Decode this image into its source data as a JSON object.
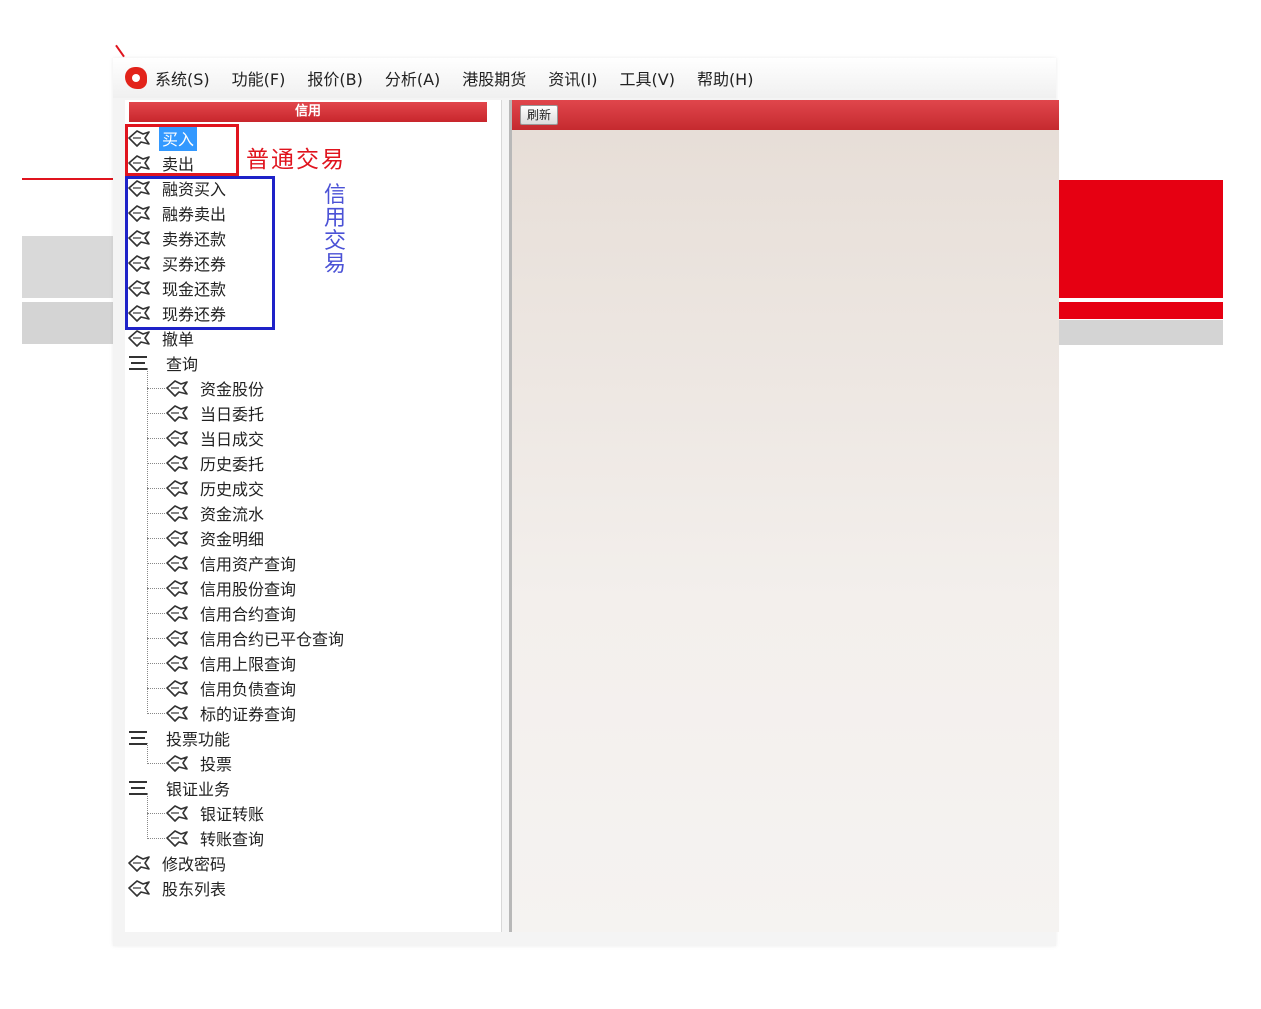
{
  "menubar": {
    "items": [
      "系统(S)",
      "功能(F)",
      "报价(B)",
      "分析(A)",
      "港股期货",
      "资讯(I)",
      "工具(V)",
      "帮助(H)"
    ]
  },
  "left_panel": {
    "header": "信用"
  },
  "tree": {
    "top_items": [
      "买入",
      "卖出",
      "融资买入",
      "融券卖出",
      "卖券还款",
      "买券还券",
      "现金还款",
      "现券还券",
      "撤单"
    ],
    "query_group": "查询",
    "query_items": [
      "资金股份",
      "当日委托",
      "当日成交",
      "历史委托",
      "历史成交",
      "资金流水",
      "资金明细",
      "信用资产查询",
      "信用股份查询",
      "信用合约查询",
      "信用合约已平仓查询",
      "信用上限查询",
      "信用负债查询",
      "标的证券查询"
    ],
    "vote_group": "投票功能",
    "vote_items": [
      "投票"
    ],
    "bank_group": "银证业务",
    "bank_items": [
      "银证转账",
      "转账查询"
    ],
    "bottom_items": [
      "修改密码",
      "股东列表"
    ],
    "selected": "买入"
  },
  "annotations": {
    "normal_trade": "普通交易",
    "credit_trade": "信用交易"
  },
  "right_panel": {
    "refresh_label": "刷新"
  },
  "colors": {
    "accent_red": "#e0141e",
    "annotation_blue": "#1e22c8",
    "selection": "#3399ff"
  }
}
